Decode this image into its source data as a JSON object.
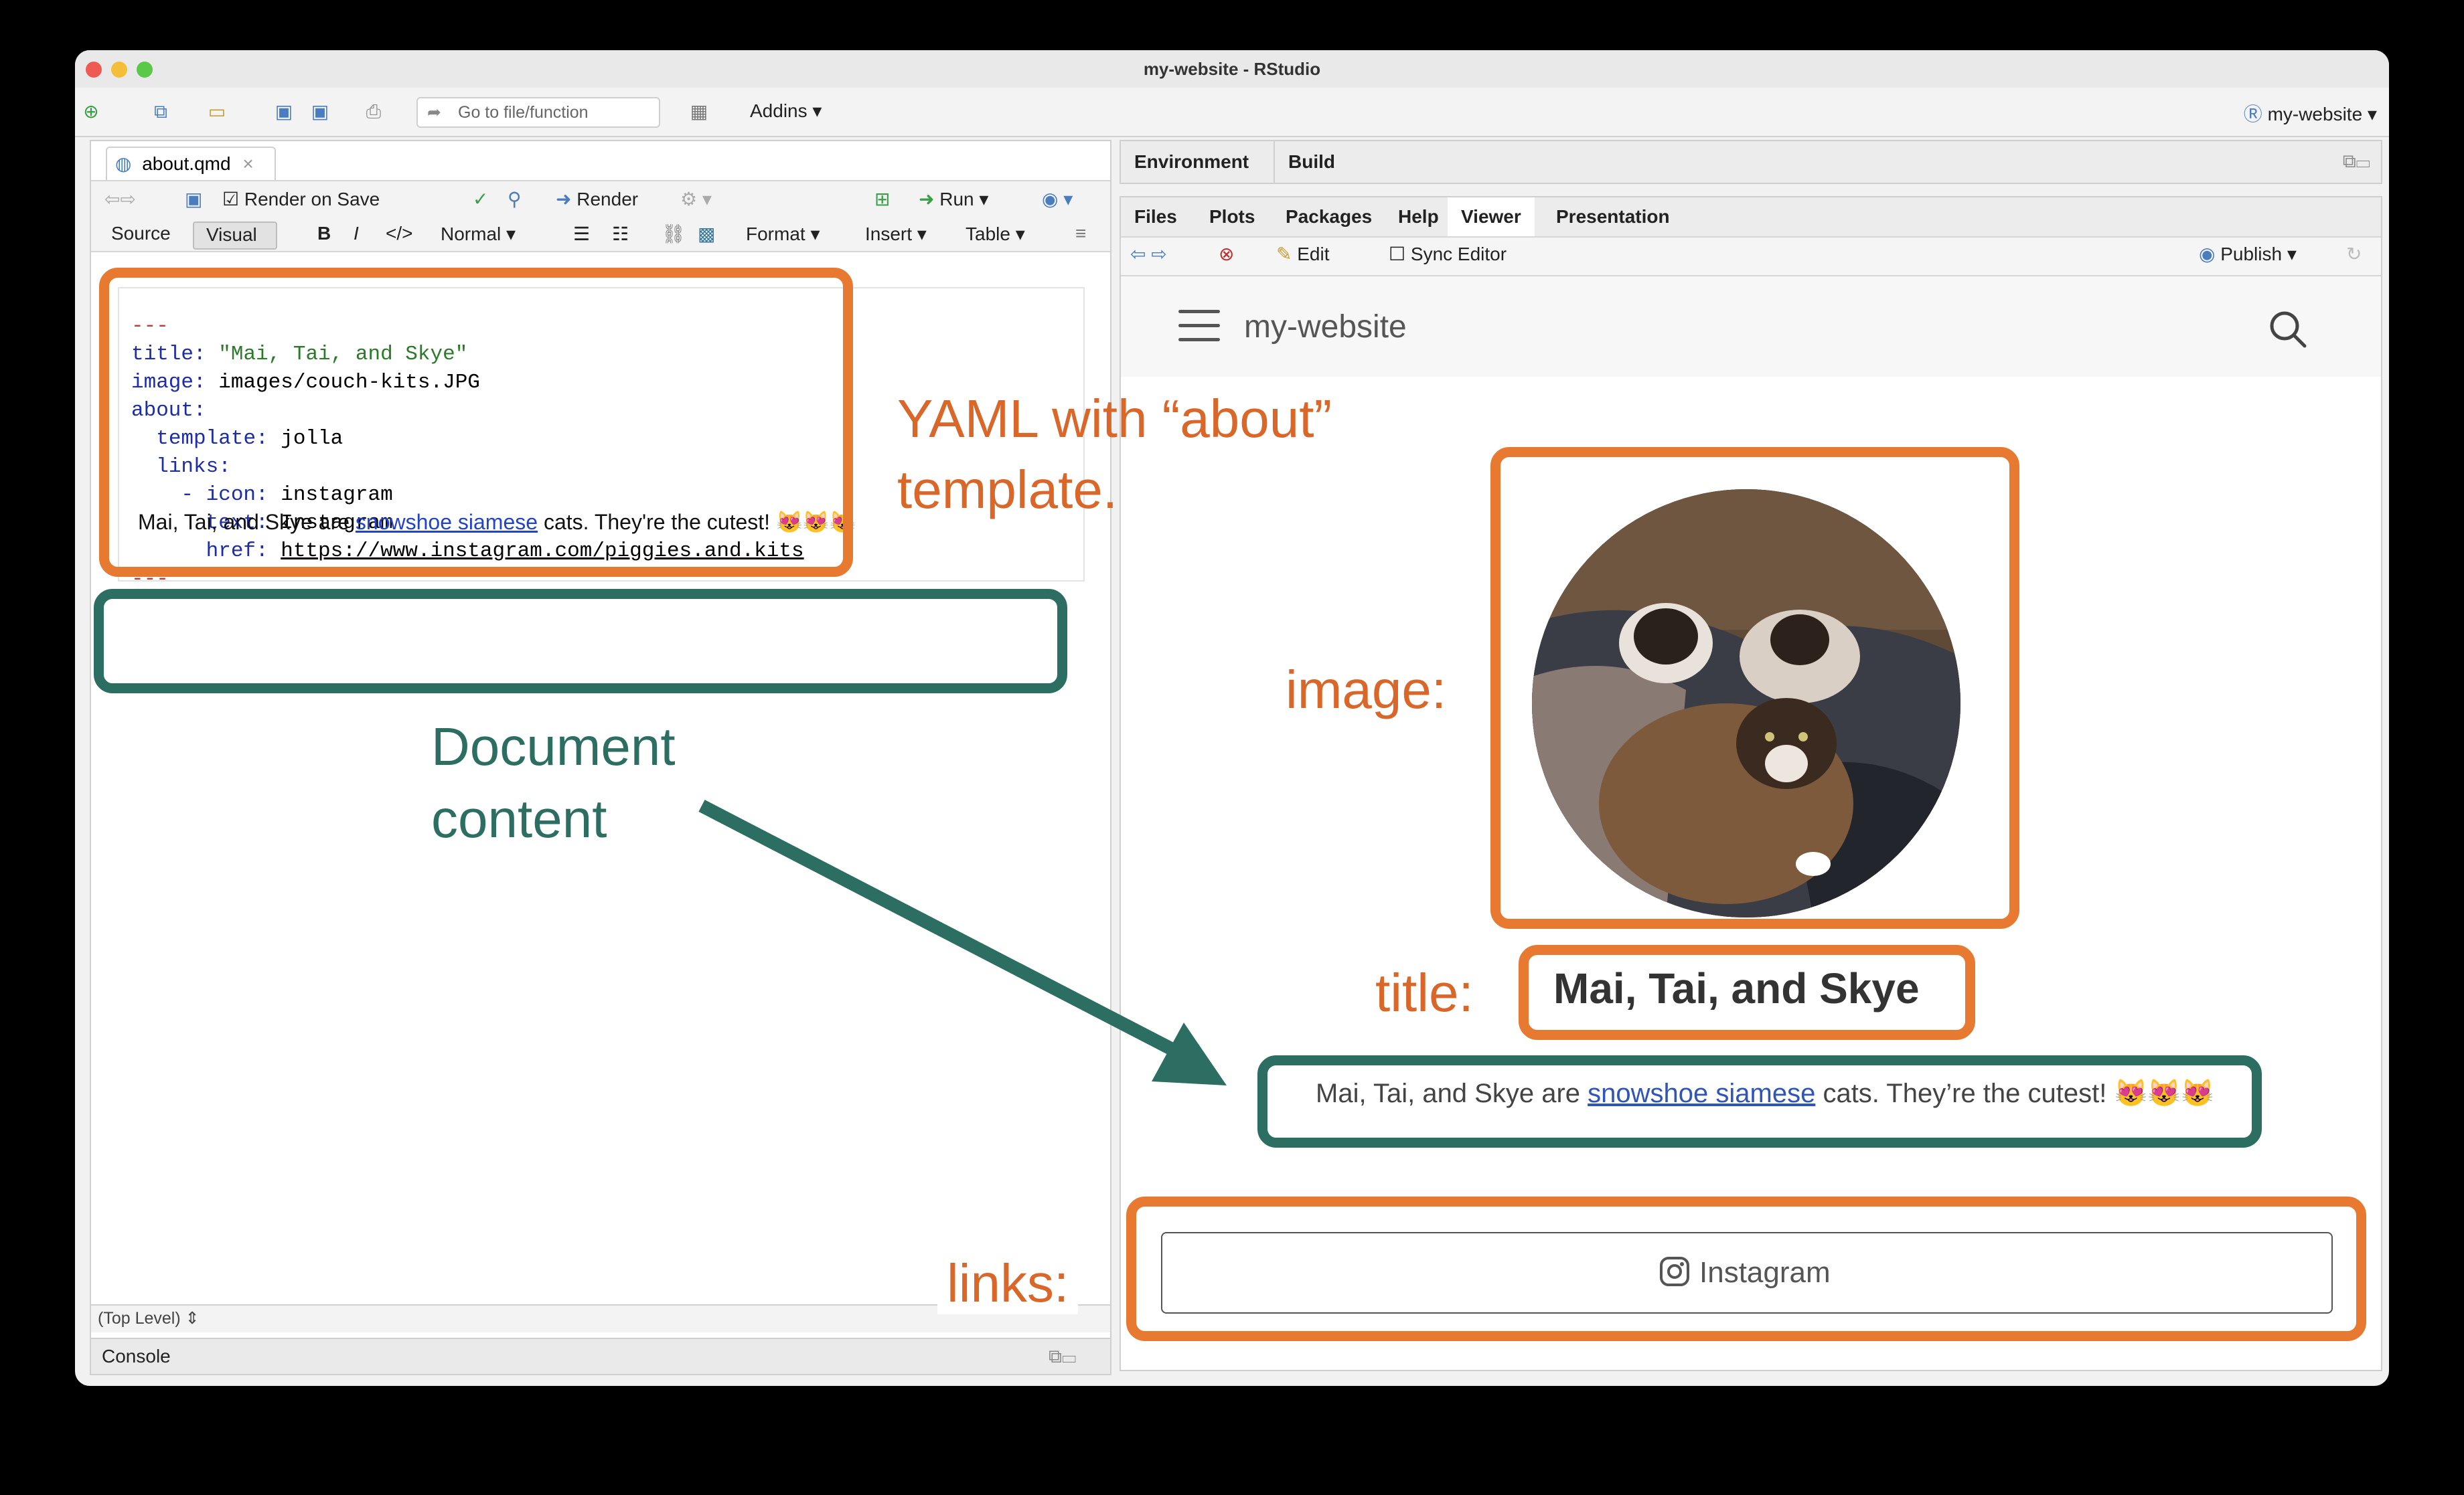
{
  "window": {
    "title": "my-website - RStudio"
  },
  "toolbar": {
    "goto_placeholder": "Go to file/function",
    "addins_label": "Addins",
    "project_label": "my-website"
  },
  "editor": {
    "file_tab": "about.qmd",
    "render_on_save_label": "Render on Save",
    "render_label": "Render",
    "run_label": "Run",
    "source_label": "Source",
    "visual_label": "Visual",
    "bold_label": "B",
    "italic_label": "I",
    "style_label": "Normal",
    "format_label": "Format",
    "insert_label": "Insert",
    "table_label": "Table",
    "yaml": {
      "fence": "---",
      "title_key": "title:",
      "title_value": "\"Mai, Tai, and Skye\"",
      "image_key": "image:",
      "image_value": "images/couch-kits.JPG",
      "about_key": "about:",
      "template_key": "template:",
      "template_value": "jolla",
      "links_key": "links:",
      "icon_key": "- icon:",
      "icon_value": "instagram",
      "text_key": "text:",
      "text_value": "Instagram",
      "href_key": "href:",
      "href_value": "https://www.instagram.com/piggies.and.kits"
    },
    "content": {
      "before": "Mai, Tai, and Skye are ",
      "link": "snowshoe siamese",
      "after": " cats. They're the cutest! 😻😻😻"
    },
    "status_level": "(Top Level) ⇕"
  },
  "console": {
    "label": "Console"
  },
  "right_top_tabs": [
    "Environment",
    "Build"
  ],
  "right_tabs": [
    "Files",
    "Plots",
    "Packages",
    "Help",
    "Viewer",
    "Presentation"
  ],
  "viewer": {
    "edit_label": "Edit",
    "sync_editor_label": "Sync Editor",
    "publish_label": "Publish",
    "site_brand": "my-website",
    "page_title": "Mai, Tai, and Skye",
    "content": {
      "before": "Mai, Tai, and Skye are ",
      "link": "snowshoe siamese",
      "after": " cats. They’re the cutest! 😻😻😻"
    },
    "link_button": "Instagram"
  },
  "annotations": {
    "yaml_line1": "YAML with “about”",
    "yaml_line2": "template.",
    "doc_line1": "Document",
    "doc_line2": "content",
    "image_label": "image:",
    "title_label": "title:",
    "links_label": "links:"
  },
  "colors": {
    "annotation_orange": "#e87930",
    "annotation_green": "#2c6e62"
  }
}
